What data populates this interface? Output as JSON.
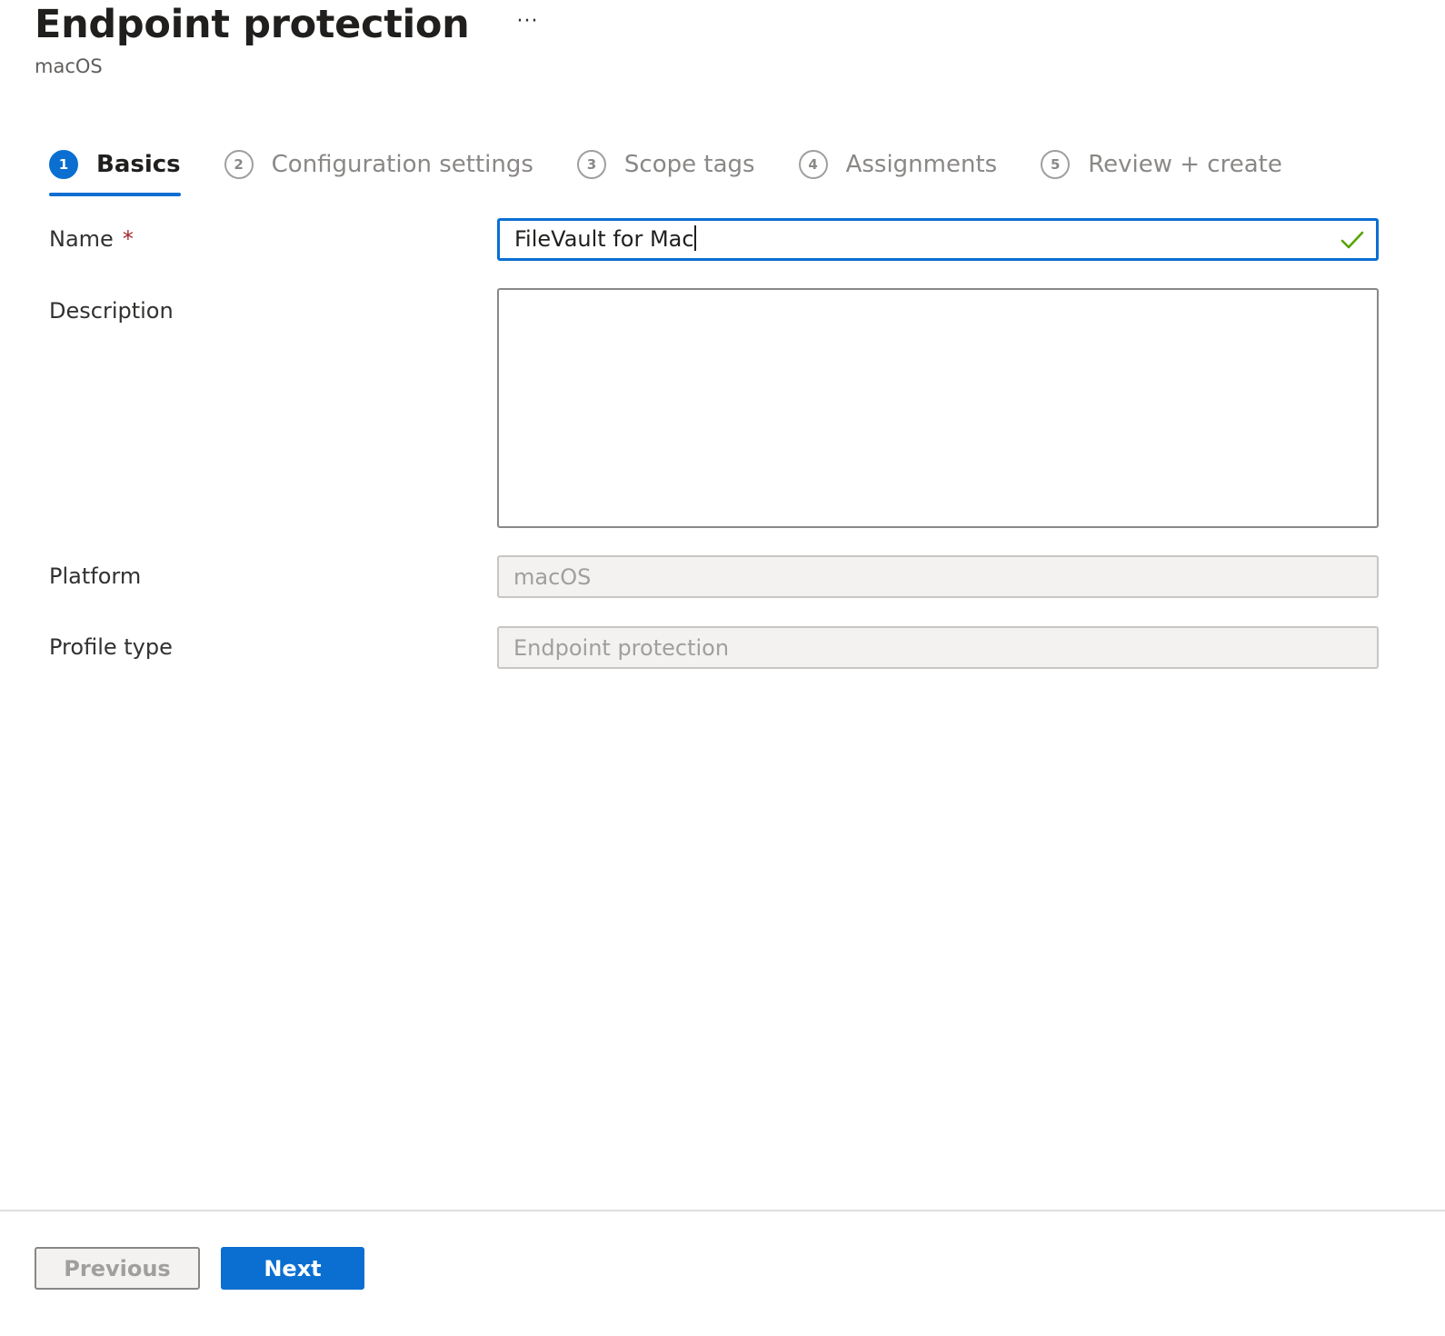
{
  "header": {
    "title": "Endpoint protection",
    "more_label": "···",
    "subtitle": "macOS"
  },
  "steps": [
    {
      "number": "1",
      "label": "Basics",
      "active": true
    },
    {
      "number": "2",
      "label": "Configuration settings",
      "active": false
    },
    {
      "number": "3",
      "label": "Scope tags",
      "active": false
    },
    {
      "number": "4",
      "label": "Assignments",
      "active": false
    },
    {
      "number": "5",
      "label": "Review + create",
      "active": false
    }
  ],
  "form": {
    "name": {
      "label": "Name",
      "required_mark": "*",
      "value": "FileVault for Mac"
    },
    "description": {
      "label": "Description",
      "value": ""
    },
    "platform": {
      "label": "Platform",
      "value": "macOS"
    },
    "profile_type": {
      "label": "Profile type",
      "value": "Endpoint protection"
    }
  },
  "footer": {
    "previous_label": "Previous",
    "next_label": "Next"
  },
  "colors": {
    "accent": "#0a6fd1",
    "success_check": "#57a300",
    "required": "#a4262c"
  },
  "icons": {
    "valid": "checkmark-icon",
    "more": "more-ellipsis-icon"
  }
}
